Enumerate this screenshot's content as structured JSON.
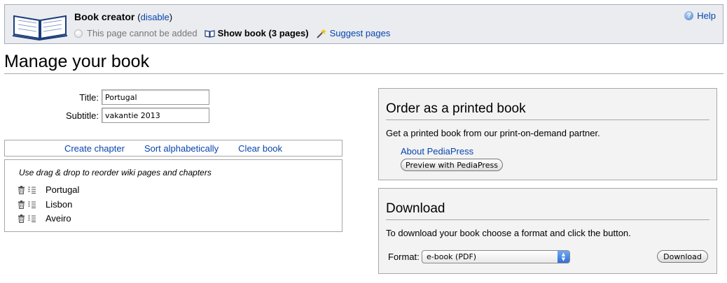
{
  "creator": {
    "title": "Book creator",
    "disable_label": "disable",
    "cannot_add": "This page cannot be added",
    "show_book": "Show book (3 pages)",
    "suggest": "Suggest pages",
    "help": "Help"
  },
  "page_title": "Manage your book",
  "form": {
    "title_label": "Title:",
    "title_value": "Portugal",
    "subtitle_label": "Subtitle:",
    "subtitle_value": "vakantie 2013"
  },
  "toolbar": {
    "create_chapter": "Create chapter",
    "sort_alpha": "Sort alphabetically",
    "clear_book": "Clear book"
  },
  "list": {
    "hint": "Use drag & drop to reorder wiki pages and chapters",
    "items": [
      {
        "label": "Portugal"
      },
      {
        "label": "Lisbon"
      },
      {
        "label": "Aveiro"
      }
    ]
  },
  "print_panel": {
    "heading": "Order as a printed book",
    "description": "Get a printed book from our print-on-demand partner.",
    "about_link": "About PediaPress",
    "preview_button": "Preview with PediaPress"
  },
  "download_panel": {
    "heading": "Download",
    "description": "To download your book choose a format and click the button.",
    "format_label": "Format:",
    "format_value": "e-book (PDF)",
    "download_button": "Download"
  },
  "colors": {
    "link": "#0645ad",
    "bar_background": "#eaecf0",
    "panel_background": "#f3f3f3"
  }
}
